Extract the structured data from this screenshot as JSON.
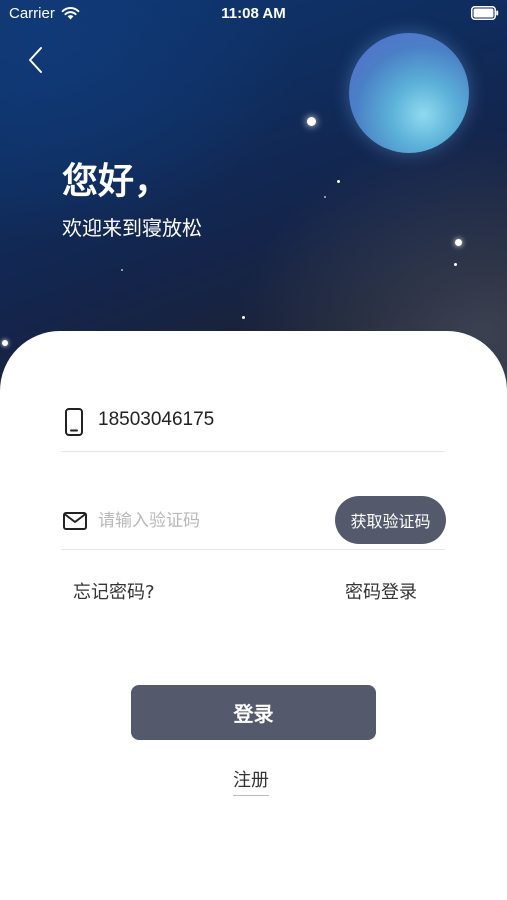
{
  "status_bar": {
    "carrier": "Carrier",
    "time": "11:08 AM"
  },
  "header": {
    "greeting": "您好，",
    "welcome": "欢迎来到寝放松"
  },
  "form": {
    "phone_value": "18503046175",
    "code_placeholder": "请输入验证码",
    "get_code_label": "获取验证码",
    "forgot_label": "忘记密码?",
    "password_login_label": "密码登录",
    "login_label": "登录",
    "register_label": "注册"
  },
  "icons": {
    "back": "chevron-left-icon",
    "phone": "smartphone-icon",
    "code": "mail-icon",
    "wifi": "wifi-icon",
    "battery": "battery-icon"
  },
  "colors": {
    "primary_button": "#545a6c",
    "moon": "#5bb0d8",
    "hero_dark": "#0f2d5e"
  }
}
